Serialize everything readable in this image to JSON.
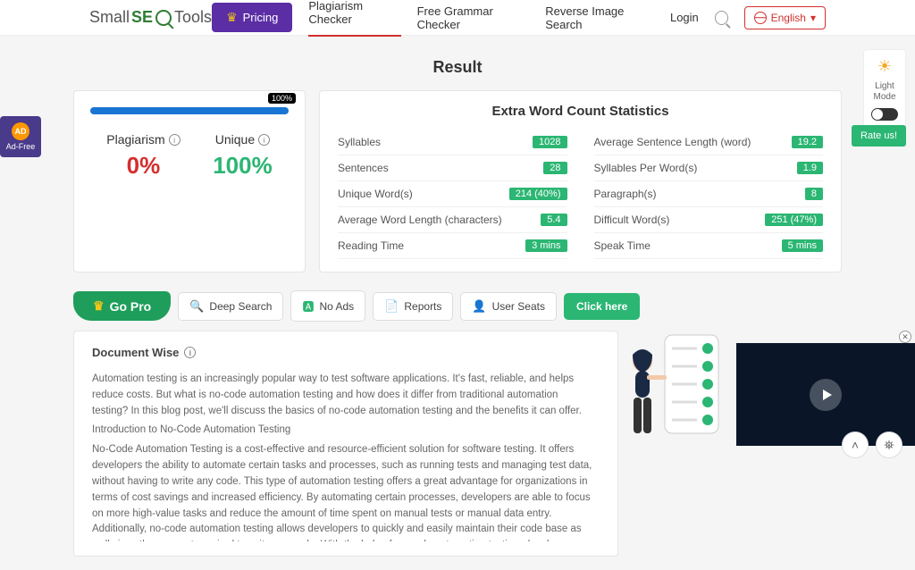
{
  "header": {
    "logo_pre": "Small",
    "logo_mid": "SE",
    "logo_post": "Tools",
    "pricing": "Pricing",
    "links": {
      "plagiarism": "Plagiarism Checker",
      "grammar": "Free Grammar Checker",
      "reverse": "Reverse Image Search",
      "login": "Login"
    },
    "language": "English"
  },
  "adfree": {
    "tag": "AD",
    "label": "Ad-Free"
  },
  "right": {
    "mode_label": "Light\nMode",
    "rate": "Rate us!"
  },
  "result": {
    "title": "Result",
    "bar_tag": "100%",
    "plag_lbl": "Plagiarism",
    "plag_val": "0%",
    "uni_lbl": "Unique",
    "uni_val": "100%"
  },
  "stats": {
    "title": "Extra Word Count Statistics",
    "rows": {
      "syllables": {
        "l": "Syllables",
        "v": "1028"
      },
      "avg_sent": {
        "l": "Average Sentence Length (word)",
        "v": "19.2"
      },
      "sent": {
        "l": "Sentences",
        "v": "28"
      },
      "spw": {
        "l": "Syllables Per Word(s)",
        "v": "1.9"
      },
      "uwords": {
        "l": "Unique Word(s)",
        "v": "214 (40%)"
      },
      "paras": {
        "l": "Paragraph(s)",
        "v": "8"
      },
      "awl": {
        "l": "Average Word Length (characters)",
        "v": "5.4"
      },
      "difw": {
        "l": "Difficult Word(s)",
        "v": "251 (47%)"
      },
      "read": {
        "l": "Reading Time",
        "v": "3 mins"
      },
      "speak": {
        "l": "Speak Time",
        "v": "5 mins"
      }
    }
  },
  "pro": {
    "gopro": "Go Pro",
    "deep": "Deep Search",
    "noads": "No Ads",
    "reports": "Reports",
    "seats": "User Seats",
    "click": "Click here"
  },
  "doc": {
    "title": "Document Wise",
    "p1": "Automation testing is an increasingly popular way to test software applications. It's fast, reliable, and helps reduce costs. But what is no-code automation testing and how does it differ from traditional automation testing? In this blog post, we'll discuss the basics of no-code automation testing and the benefits it can offer.",
    "p2": "Introduction to No-Code Automation Testing",
    "p3": "No-Code Automation Testing is a cost-effective and resource-efficient solution for software testing. It offers developers the ability to automate certain tasks and processes, such as running tests and managing test data, without having to write any code. This type of automation testing offers a great advantage for organizations in terms of cost savings and increased efficiency. By automating certain processes, developers are able to focus on more high-value tasks and reduce the amount of time spent on manual tests or manual data entry. Additionally, no-code automation testing allows developers to quickly and easily maintain their code base as well since they are not required to write any code. With the help of no-code automation testing, developers can streamline the software development process while still ensuring the highest quality results."
  }
}
